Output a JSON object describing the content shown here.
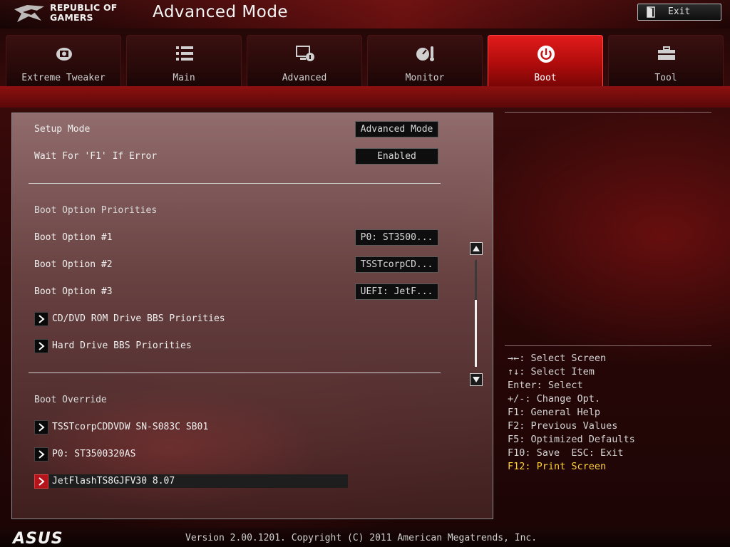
{
  "header": {
    "brand_line1": "REPUBLIC OF",
    "brand_line2": "GAMERS",
    "mode_title": "Advanced Mode",
    "exit_label": "Exit"
  },
  "tabs": [
    {
      "label": "Extreme Tweaker",
      "icon": "tweaker-icon",
      "active": false
    },
    {
      "label": "Main",
      "icon": "list-icon",
      "active": false
    },
    {
      "label": "Advanced",
      "icon": "advanced-icon",
      "active": false
    },
    {
      "label": "Monitor",
      "icon": "monitor-gauge-icon",
      "active": false
    },
    {
      "label": "Boot",
      "icon": "power-icon",
      "active": true
    },
    {
      "label": "Tool",
      "icon": "toolbox-icon",
      "active": false
    }
  ],
  "settings": {
    "setup_mode": {
      "label": "Setup Mode",
      "value": "Advanced Mode"
    },
    "wait_f1": {
      "label": "Wait For 'F1' If Error",
      "value": "Enabled"
    }
  },
  "boot_priorities": {
    "heading": "Boot Option Priorities",
    "options": [
      {
        "label": "Boot Option #1",
        "value": "P0: ST3500..."
      },
      {
        "label": "Boot Option #2",
        "value": "TSSTcorpCD..."
      },
      {
        "label": "Boot Option #3",
        "value": "UEFI: JetF..."
      }
    ],
    "submenus": [
      {
        "label": "CD/DVD ROM Drive BBS Priorities"
      },
      {
        "label": "Hard Drive BBS Priorities"
      }
    ]
  },
  "boot_override": {
    "heading": "Boot Override",
    "items": [
      {
        "label": "TSSTcorpCDDVDW SN-S083C SB01",
        "selected": false
      },
      {
        "label": "P0: ST3500320AS",
        "selected": false
      },
      {
        "label": "JetFlashTS8GJFV30 8.07",
        "selected": true
      }
    ]
  },
  "help": {
    "lines": [
      "→←: Select Screen",
      "↑↓: Select Item",
      "Enter: Select",
      "+/-: Change Opt.",
      "F1: General Help",
      "F2: Previous Values",
      "F5: Optimized Defaults",
      "F10: Save  ESC: Exit"
    ],
    "highlight_line": "F12: Print Screen"
  },
  "footer": {
    "brand": "ASUS",
    "version": "Version 2.00.1201. Copyright (C) 2011 American Megatrends, Inc."
  },
  "colors": {
    "accent_red": "#c81010",
    "help_highlight": "#ffd23a",
    "panel_border": "#8c8c8c"
  }
}
